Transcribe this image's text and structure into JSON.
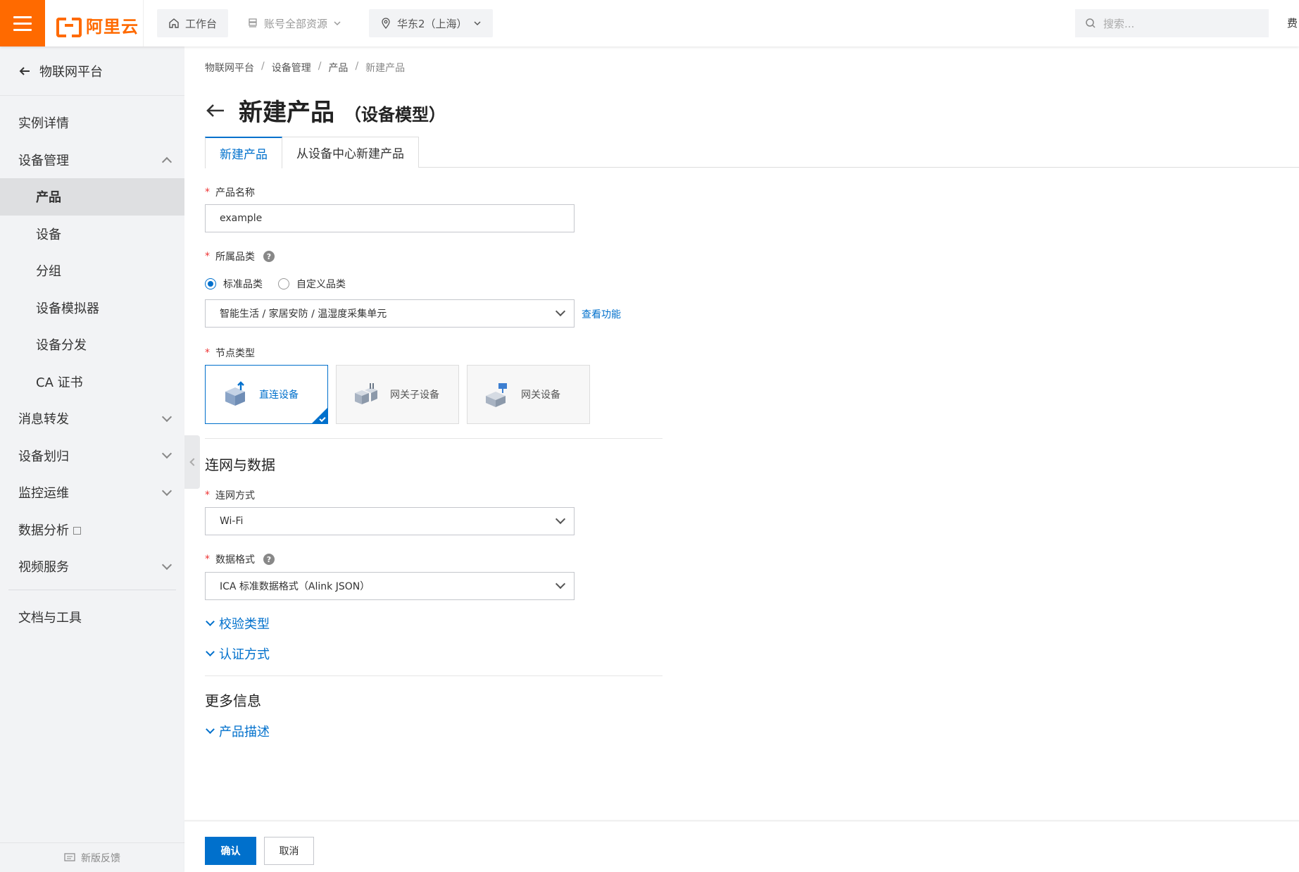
{
  "topbar": {
    "logo_text": "阿里云",
    "workbench": "工作台",
    "resources": "账号全部资源",
    "region": "华东2（上海）",
    "search_placeholder": "搜索...",
    "fee": "费"
  },
  "sidebar": {
    "back_label": "物联网平台",
    "items": [
      {
        "label": "实例详情"
      },
      {
        "label": "设备管理"
      },
      {
        "label": "产品"
      },
      {
        "label": "设备"
      },
      {
        "label": "分组"
      },
      {
        "label": "设备模拟器"
      },
      {
        "label": "设备分发"
      },
      {
        "label": "CA 证书"
      },
      {
        "label": "消息转发"
      },
      {
        "label": "设备划归"
      },
      {
        "label": "监控运维"
      },
      {
        "label": "数据分析"
      },
      {
        "label": "视频服务"
      },
      {
        "label": "文档与工具"
      }
    ],
    "feedback": "新版反馈"
  },
  "breadcrumb": [
    "物联网平台",
    "设备管理",
    "产品",
    "新建产品"
  ],
  "page": {
    "title": "新建产品",
    "subtitle": "（设备模型）"
  },
  "tabs": [
    "新建产品",
    "从设备中心新建产品"
  ],
  "form": {
    "product_name_label": "产品名称",
    "product_name_value": "example",
    "category_label": "所属品类",
    "category_options": [
      "标准品类",
      "自定义品类"
    ],
    "category_value": "智能生活 / 家居安防 / 温湿度采集单元",
    "view_function_link": "查看功能",
    "node_type_label": "节点类型",
    "node_types": [
      "直连设备",
      "网关子设备",
      "网关设备"
    ],
    "section_network": "连网与数据",
    "network_label": "连网方式",
    "network_value": "Wi-Fi",
    "data_format_label": "数据格式",
    "data_format_value": "ICA 标准数据格式（Alink JSON）",
    "verify_type": "校验类型",
    "auth_method": "认证方式",
    "section_more": "更多信息",
    "product_desc": "产品描述"
  },
  "footer": {
    "confirm": "确认",
    "cancel": "取消"
  },
  "colors": {
    "brand": "#ff6a00",
    "primary": "#0070cc"
  }
}
